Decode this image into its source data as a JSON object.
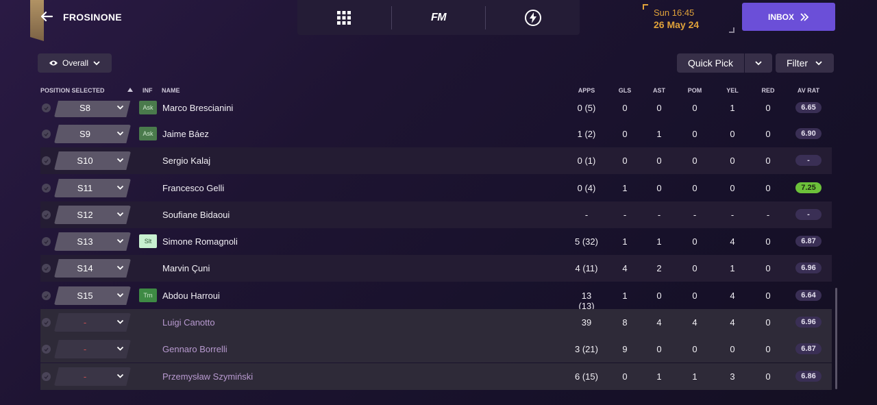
{
  "header": {
    "club_name": "FROSINONE",
    "date_time": "Sun 16:45",
    "date_day": "26 May 24",
    "inbox_label": "INBOX",
    "nav_logo": "FM"
  },
  "toolbar": {
    "view_label": "Overall",
    "quick_pick_label": "Quick Pick",
    "filter_label": "Filter"
  },
  "columns": {
    "position": "POSITION SELECTED",
    "inf": "INF",
    "name": "NAME",
    "apps": "APPS",
    "gls": "GLS",
    "ast": "AST",
    "pom": "POM",
    "yel": "YEL",
    "red": "RED",
    "av_rat": "AV RAT"
  },
  "rows": [
    {
      "pos": "S8",
      "inf": "Ask",
      "name": "Marco Brescianini",
      "apps": "0 (5)",
      "gls": "0",
      "ast": "0",
      "pom": "0",
      "yel": "1",
      "red": "0",
      "rat": "6.65"
    },
    {
      "pos": "S9",
      "inf": "Ask",
      "name": "Jaime Báez",
      "apps": "1 (2)",
      "gls": "0",
      "ast": "1",
      "pom": "0",
      "yel": "0",
      "red": "0",
      "rat": "6.90"
    },
    {
      "pos": "S10",
      "inf": "",
      "name": "Sergio Kalaj",
      "apps": "0 (1)",
      "gls": "0",
      "ast": "0",
      "pom": "0",
      "yel": "0",
      "red": "0",
      "rat": "-"
    },
    {
      "pos": "S11",
      "inf": "",
      "name": "Francesco Gelli",
      "apps": "0 (4)",
      "gls": "1",
      "ast": "0",
      "pom": "0",
      "yel": "0",
      "red": "0",
      "rat": "7.25"
    },
    {
      "pos": "S12",
      "inf": "",
      "name": "Soufiane Bidaoui",
      "apps": "-",
      "gls": "-",
      "ast": "-",
      "pom": "-",
      "yel": "-",
      "red": "-",
      "rat": "-"
    },
    {
      "pos": "S13",
      "inf": "Slt",
      "name": "Simone Romagnoli",
      "apps": "5 (32)",
      "gls": "1",
      "ast": "1",
      "pom": "0",
      "yel": "4",
      "red": "0",
      "rat": "6.87"
    },
    {
      "pos": "S14",
      "inf": "",
      "name": "Marvin Çuni",
      "apps": "4 (11)",
      "gls": "4",
      "ast": "2",
      "pom": "0",
      "yel": "1",
      "red": "0",
      "rat": "6.96"
    },
    {
      "pos": "S15",
      "inf": "Trn",
      "name": "Abdou Harroui",
      "apps": "13 (13)",
      "gls": "1",
      "ast": "0",
      "pom": "0",
      "yel": "4",
      "red": "0",
      "rat": "6.64"
    },
    {
      "pos": "-",
      "inf": "",
      "name": "Luigi Canotto",
      "apps": "39",
      "gls": "8",
      "ast": "4",
      "pom": "4",
      "yel": "4",
      "red": "0",
      "rat": "6.96"
    },
    {
      "pos": "-",
      "inf": "",
      "name": "Gennaro Borrelli",
      "apps": "3 (21)",
      "gls": "9",
      "ast": "0",
      "pom": "0",
      "yel": "0",
      "red": "0",
      "rat": "6.87"
    },
    {
      "pos": "-",
      "inf": "",
      "name": "Przemysław Szymiński",
      "apps": "6 (15)",
      "gls": "0",
      "ast": "1",
      "pom": "1",
      "yel": "3",
      "red": "0",
      "rat": "6.86"
    }
  ],
  "colors": {
    "accent": "#6b4fd8",
    "date": "#e0a23a",
    "rating_good": "#6cc13a",
    "loan_name": "#b89ad0"
  },
  "icons": {
    "back": "arrow-left-icon",
    "grid": "grid-icon",
    "lightning": "lightning-icon",
    "eye": "eye-icon",
    "chevron": "chevron-down-icon",
    "sort": "sort-up-icon",
    "inbox_arrow": "double-chevron-right-icon"
  }
}
